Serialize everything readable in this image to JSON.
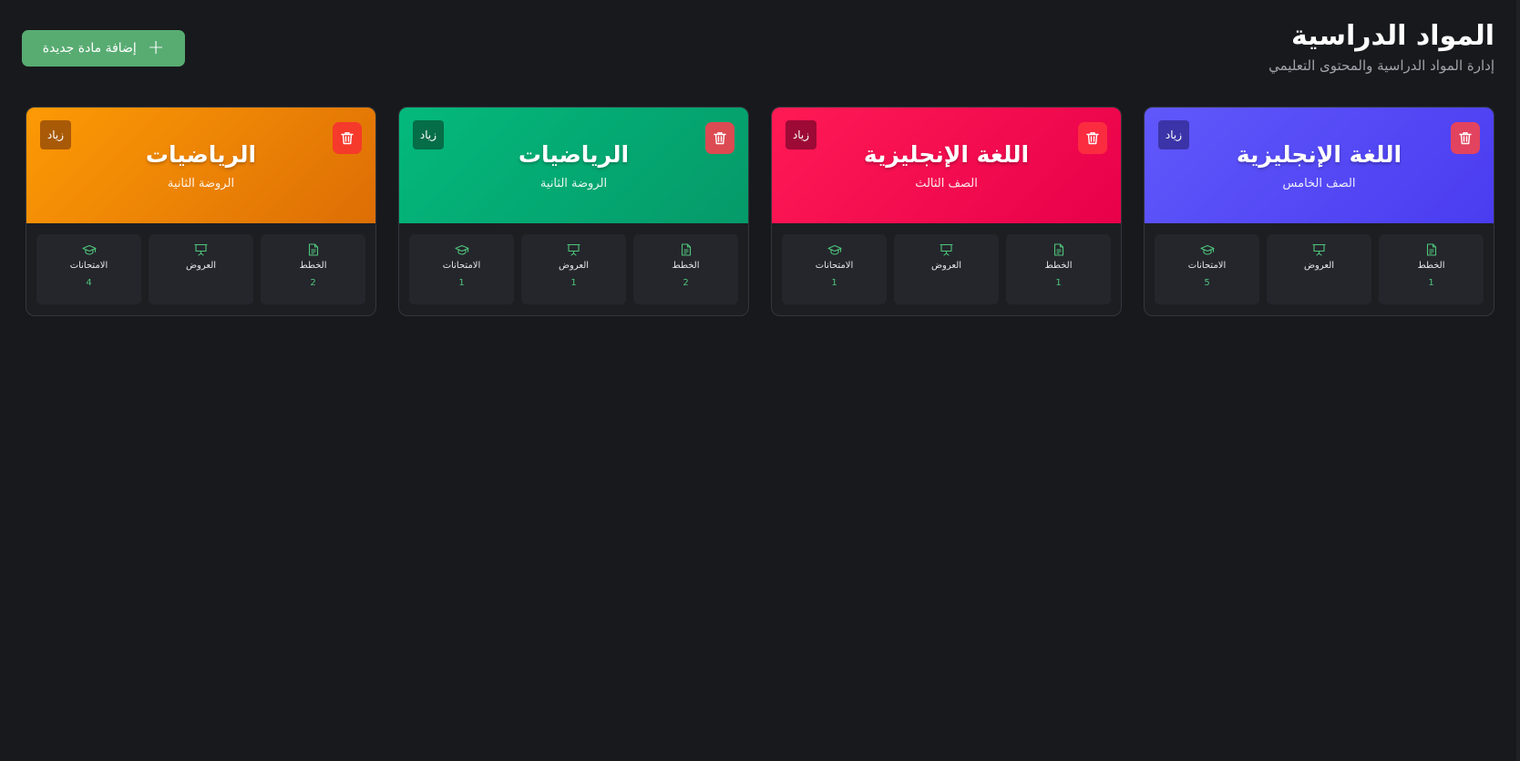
{
  "header": {
    "title": "المواد الدراسية",
    "subtitle": "إدارة المواد الدراسية والمحتوى التعليمي"
  },
  "add_button": {
    "label": "إضافة مادة جديدة",
    "icon": "plus-icon"
  },
  "stat_labels": {
    "plans": "الخطط",
    "presentations": "العروض",
    "exams": "الامتحانات"
  },
  "subjects": [
    {
      "title": "اللغة الإنجليزية",
      "grade": "الصف الخامس",
      "teacher": "زياد",
      "color_start": "#6058fb",
      "color_end": "#4a3cf0",
      "badge_bg": "#3b34a8",
      "trash_bg": "#e2435e",
      "plans": "1",
      "presentations": "",
      "exams": "5"
    },
    {
      "title": "اللغة الإنجليزية",
      "grade": "الصف الثالث",
      "teacher": "زياد",
      "color_start": "#ff1a55",
      "color_end": "#e8004a",
      "badge_bg": "#9c0a35",
      "trash_bg": "#fb2c3f",
      "plans": "1",
      "presentations": "",
      "exams": "1"
    },
    {
      "title": "الرياضيات",
      "grade": "الروضة الثانية",
      "teacher": "زياد",
      "color_start": "#04b97c",
      "color_end": "#059a69",
      "badge_bg": "#056d48",
      "trash_bg": "#dc4a52",
      "plans": "2",
      "presentations": "1",
      "exams": "1"
    },
    {
      "title": "الرياضيات",
      "grade": "الروضة الثانية",
      "teacher": "زياد",
      "color_start": "#fd9a05",
      "color_end": "#dd6e05",
      "badge_bg": "#a85a07",
      "trash_bg": "#f5392b",
      "plans": "2",
      "presentations": "",
      "exams": "4"
    }
  ],
  "colors": {
    "accent": "#58ac72",
    "stat_value": "#4fc47a",
    "background": "#18191d"
  },
  "icons": {
    "delete": "trash-icon",
    "plans": "document-icon",
    "presentations": "presentation-icon",
    "exams": "graduation-cap-icon"
  }
}
